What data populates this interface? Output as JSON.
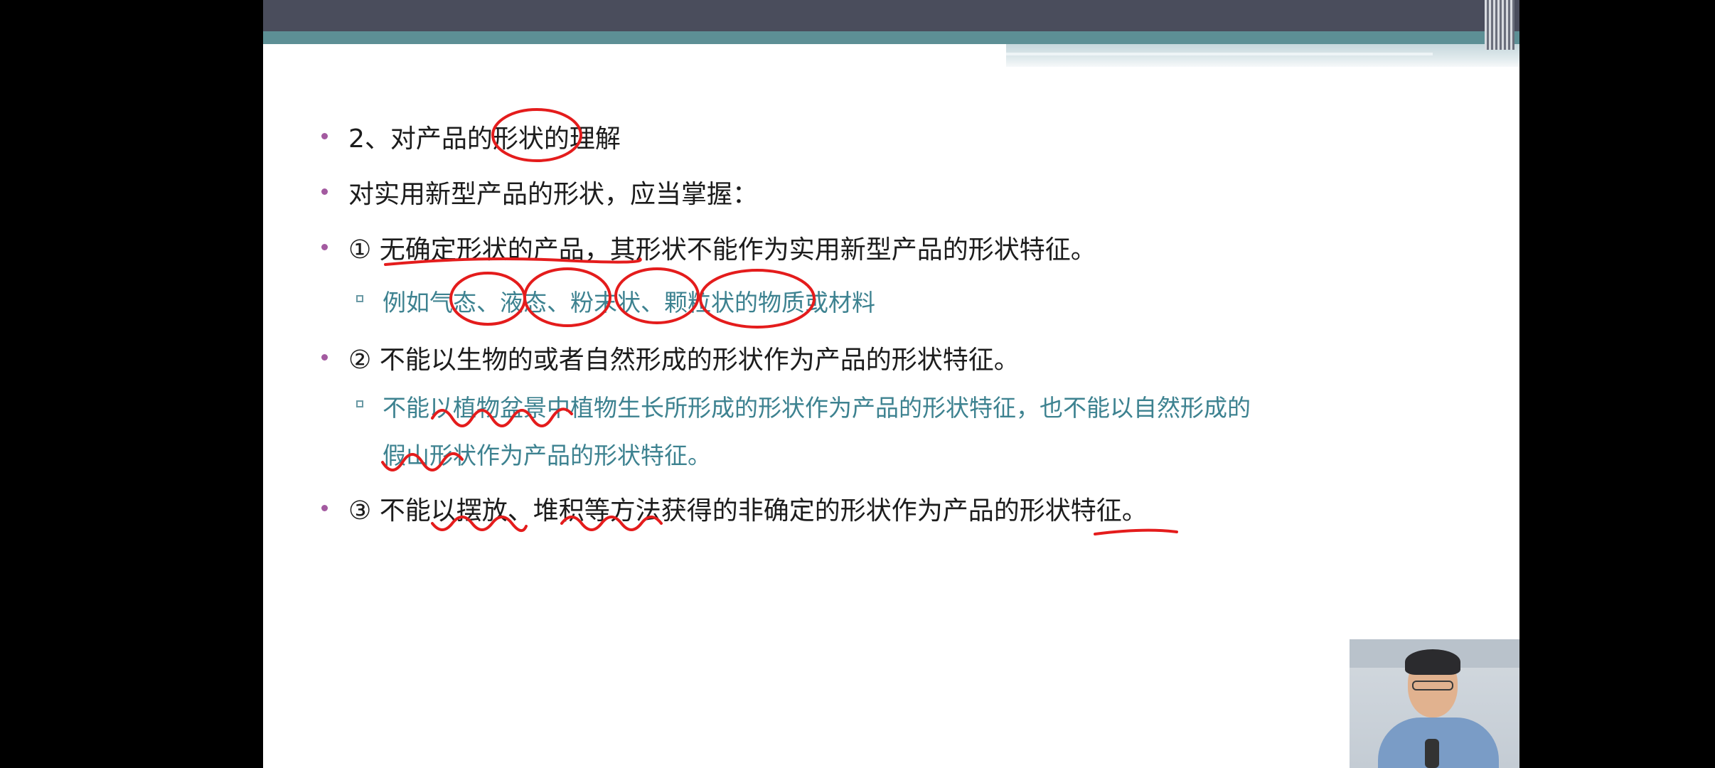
{
  "slide": {
    "items": [
      {
        "level": 1,
        "text": "2、对产品的形状的理解"
      },
      {
        "level": 1,
        "text": "对实用新型产品的形状，应当掌握："
      },
      {
        "level": 1,
        "text": "① 无确定形状的产品，其形状不能作为实用新型产品的形状特征。"
      },
      {
        "level": 2,
        "text": "例如气态、液态、粉末状、颗粒状的物质或材料"
      },
      {
        "level": 1,
        "text": "② 不能以生物的或者自然形成的形状作为产品的形状特征。"
      },
      {
        "level": 2,
        "text": "不能以植物盆景中植物生长所形成的形状作为产品的形状特征，也不能以自然形成的"
      },
      {
        "level": 2,
        "text": "假山形状作为产品的形状特征。"
      },
      {
        "level": 1,
        "text": "③ 不能以摆放、堆积等方法获得的非确定的形状作为产品的形状特征。"
      }
    ]
  },
  "colors": {
    "title_bar_dark": "#4a4d5c",
    "title_bar_teal": "#5d8f95",
    "bullet_level1": "#a35aa0",
    "text_level1": "#1c1c1c",
    "text_level2": "#3d8290",
    "annotation_red": "#e41c1c"
  },
  "webcam": {
    "description_icon": "presenter-video-icon"
  }
}
